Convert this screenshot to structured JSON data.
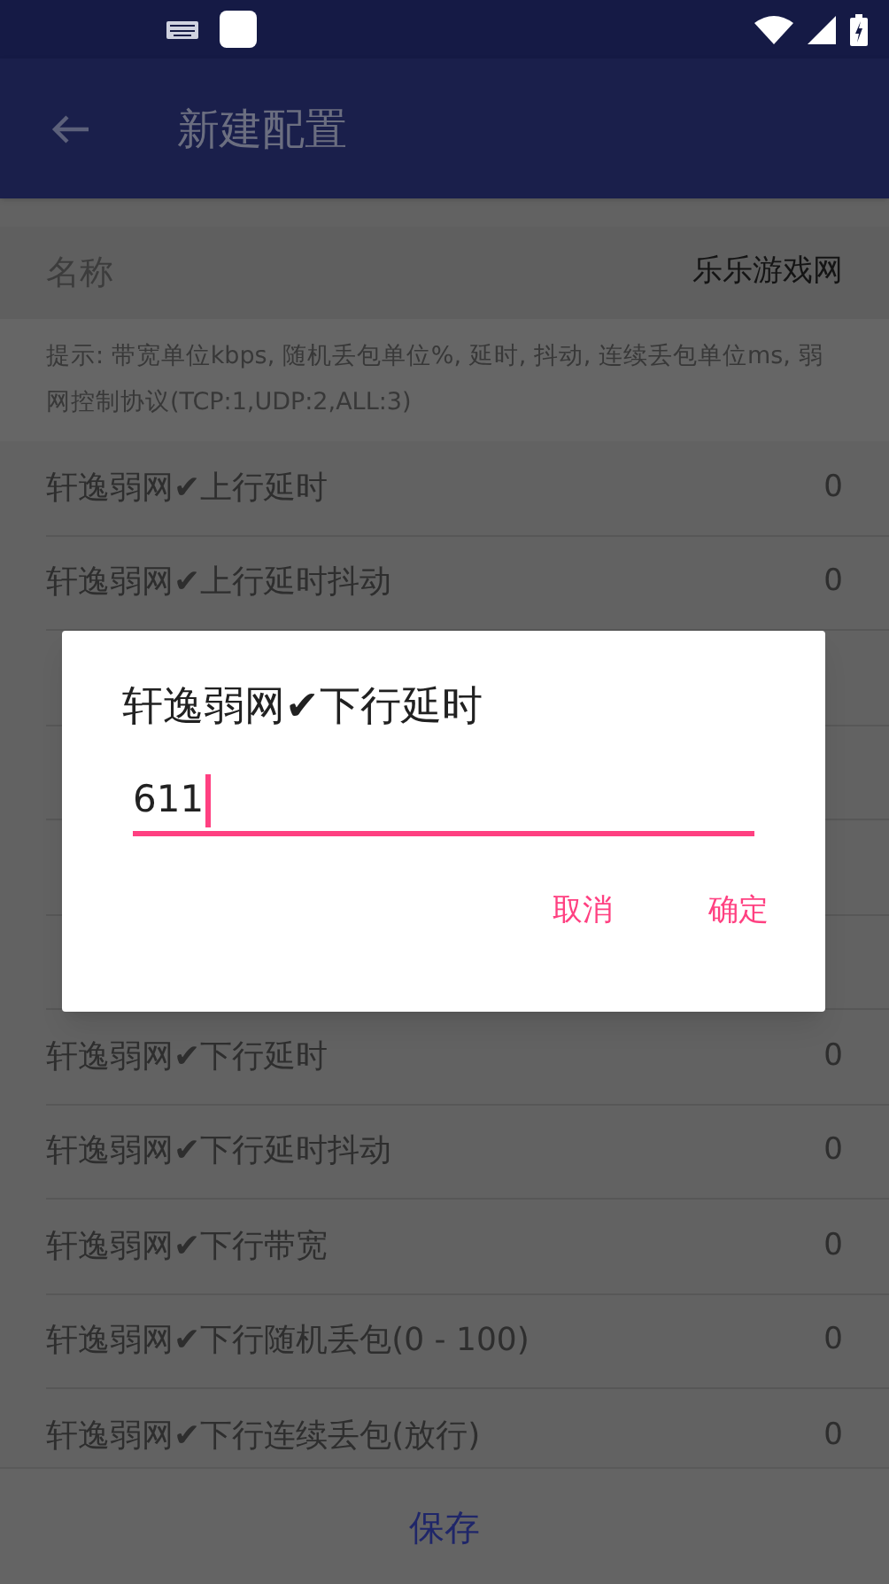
{
  "app_bar": {
    "title": "新建配置"
  },
  "name_row": {
    "label": "名称",
    "value": "乐乐游戏网"
  },
  "hint": "提示: 带宽单位kbps, 随机丢包单位%, 延时, 抖动, 连续丢包单位ms, 弱网控制协议(TCP:1,UDP:2,ALL:3)",
  "rows": [
    {
      "kind": "setting",
      "label": "轩逸弱网✔上行延时",
      "value": "0"
    },
    {
      "kind": "setting",
      "label": "轩逸弱网✔上行延时抖动",
      "value": "0"
    },
    {
      "kind": "covered"
    },
    {
      "kind": "covered"
    },
    {
      "kind": "covered"
    },
    {
      "kind": "covered"
    },
    {
      "kind": "setting",
      "label": "轩逸弱网✔下行延时",
      "value": "0"
    },
    {
      "kind": "setting",
      "label": "轩逸弱网✔下行延时抖动",
      "value": "0"
    },
    {
      "kind": "setting",
      "label": "轩逸弱网✔下行带宽",
      "value": "0"
    },
    {
      "kind": "setting",
      "label": "轩逸弱网✔下行随机丢包(0 - 100)",
      "value": "0"
    },
    {
      "kind": "setting",
      "label": "轩逸弱网✔下行连续丢包(放行)",
      "value": "0"
    }
  ],
  "bottom_button": "保存",
  "dialog": {
    "title": "轩逸弱网✔下行延时",
    "value": "611",
    "buttons": [
      "取消",
      "确定"
    ]
  }
}
